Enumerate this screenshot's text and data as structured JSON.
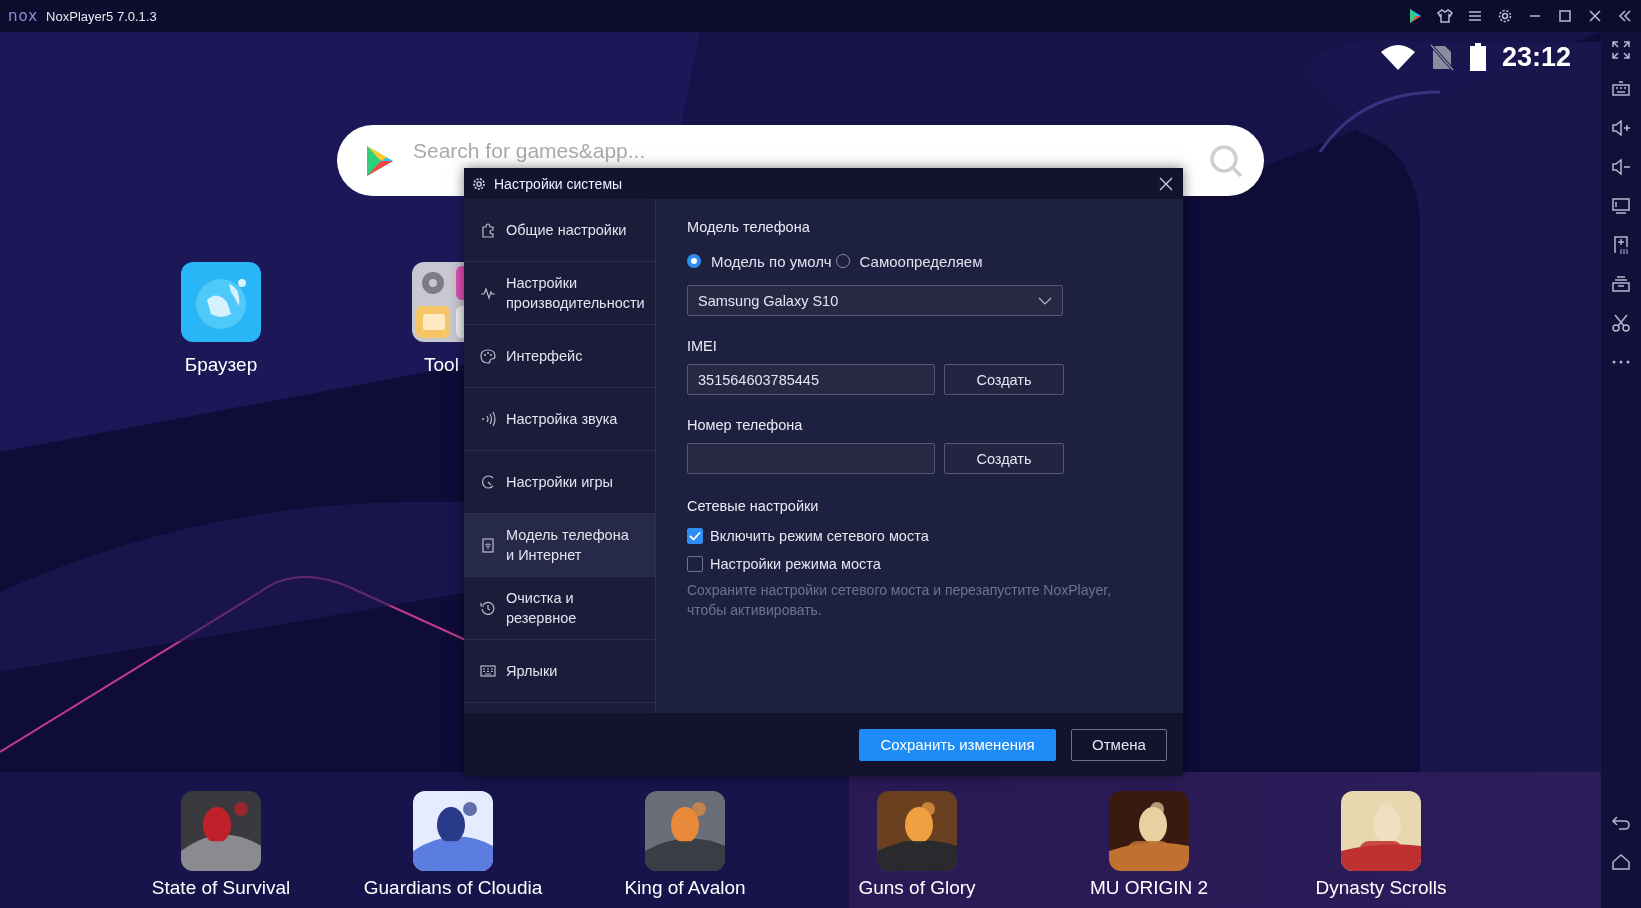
{
  "window": {
    "logo": "nox",
    "title": "NoxPlayer5 7.0.1.3"
  },
  "status_bar": {
    "time": "23:12"
  },
  "search": {
    "placeholder": "Search for games&app..."
  },
  "home_apps": [
    {
      "label": "Браузер"
    },
    {
      "label": "Tool"
    }
  ],
  "dialog": {
    "title": "Настройки системы",
    "nav": [
      {
        "label": "Общие настройки",
        "selected": false
      },
      {
        "label": "Настройки\nпроизводительности",
        "selected": false
      },
      {
        "label": "Интерфейс",
        "selected": false
      },
      {
        "label": "Настройка звука",
        "selected": false
      },
      {
        "label": "Настройки игры",
        "selected": false
      },
      {
        "label": "Модель телефона\nи Интернет",
        "selected": true
      },
      {
        "label": "Очистка и\nрезервное",
        "selected": false
      },
      {
        "label": "Ярлыки",
        "selected": false
      }
    ],
    "phone_model": {
      "title": "Модель телефона",
      "radios": [
        {
          "label": "Модель по умолч",
          "selected": true
        },
        {
          "label": "Самоопределяем",
          "selected": false
        }
      ],
      "model": "Samsung Galaxy S10"
    },
    "imei": {
      "label": "IMEI",
      "value": "351564603785445",
      "button": "Создать"
    },
    "phone_number": {
      "label": "Номер телефона",
      "button": "Создать"
    },
    "network": {
      "title": "Сетевые настройки",
      "options": [
        {
          "label": "Включить режим сетевого моста",
          "checked": true
        },
        {
          "label": "Настройки режима моста",
          "checked": false
        }
      ],
      "note": "Сохраните настройки сетевого моста и перезапустите NoxPlayer, чтобы активировать."
    },
    "buttons": [
      {
        "label": "Сохранить изменения",
        "kind": "primary"
      },
      {
        "label": "Отмена",
        "kind": "secondary"
      }
    ]
  },
  "dock": [
    {
      "label": "State of Survival"
    },
    {
      "label": "Guardians of Cloudia"
    },
    {
      "label": "King of Avalon"
    },
    {
      "label": "Guns of Glory"
    },
    {
      "label": "MU ORIGIN 2"
    },
    {
      "label": "Dynasty Scrolls"
    }
  ]
}
